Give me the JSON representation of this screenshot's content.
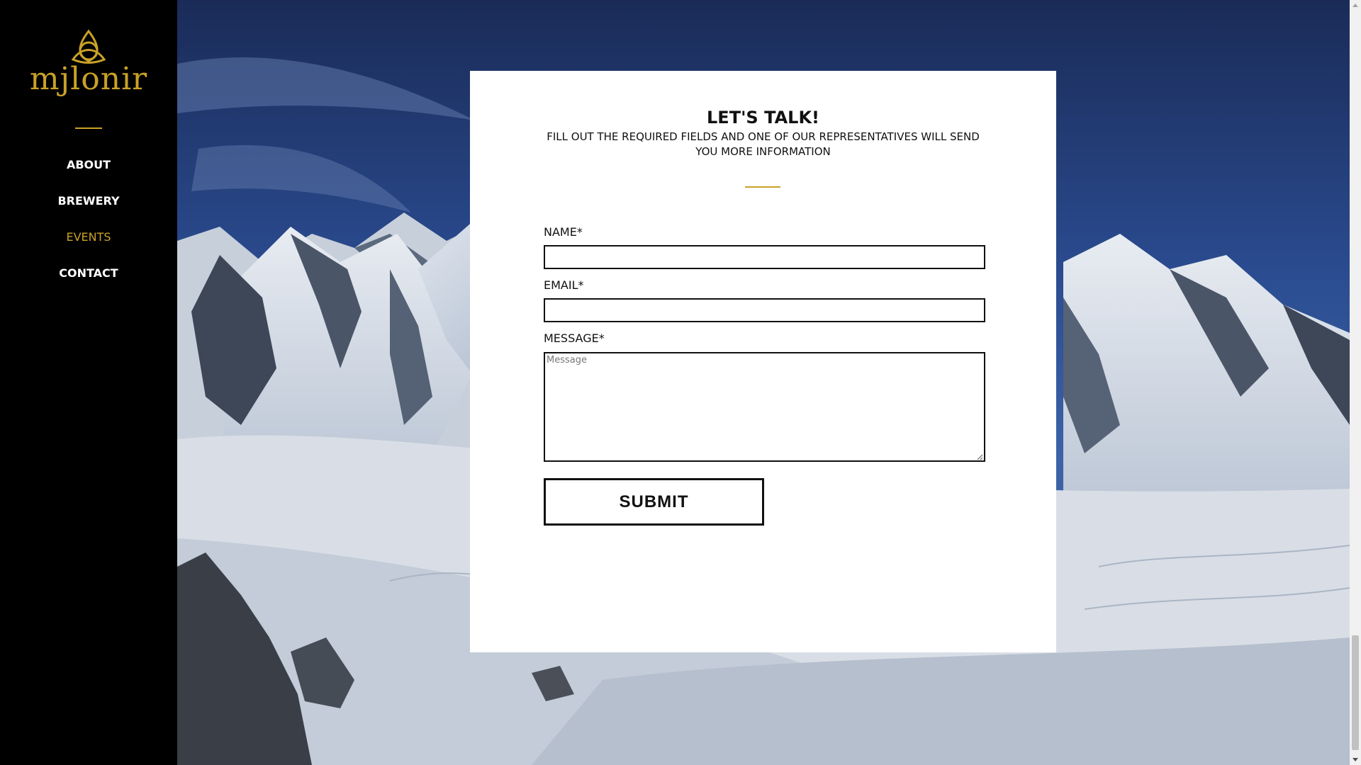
{
  "brand": {
    "name": "mjlonir",
    "accent_color": "#c9a227",
    "icon": "celtic-knot-icon"
  },
  "nav": {
    "items": [
      {
        "label": "ABOUT",
        "active": false
      },
      {
        "label": "BREWERY",
        "active": false
      },
      {
        "label": "EVENTS",
        "active": true
      },
      {
        "label": "CONTACT",
        "active": false
      }
    ]
  },
  "form": {
    "title": "LET'S TALK!",
    "subtitle": "FILL OUT THE REQUIRED FIELDS AND ONE OF OUR REPRESENTATIVES WILL SEND YOU MORE INFORMATION",
    "name_label": "NAME*",
    "name_value": "",
    "email_label": "EMAIL*",
    "email_value": "",
    "message_label": "MESSAGE*",
    "message_placeholder": "Message",
    "message_value": "",
    "submit_label": "SUBMIT"
  },
  "background": {
    "description_icon": "snowy-mountains-image"
  }
}
